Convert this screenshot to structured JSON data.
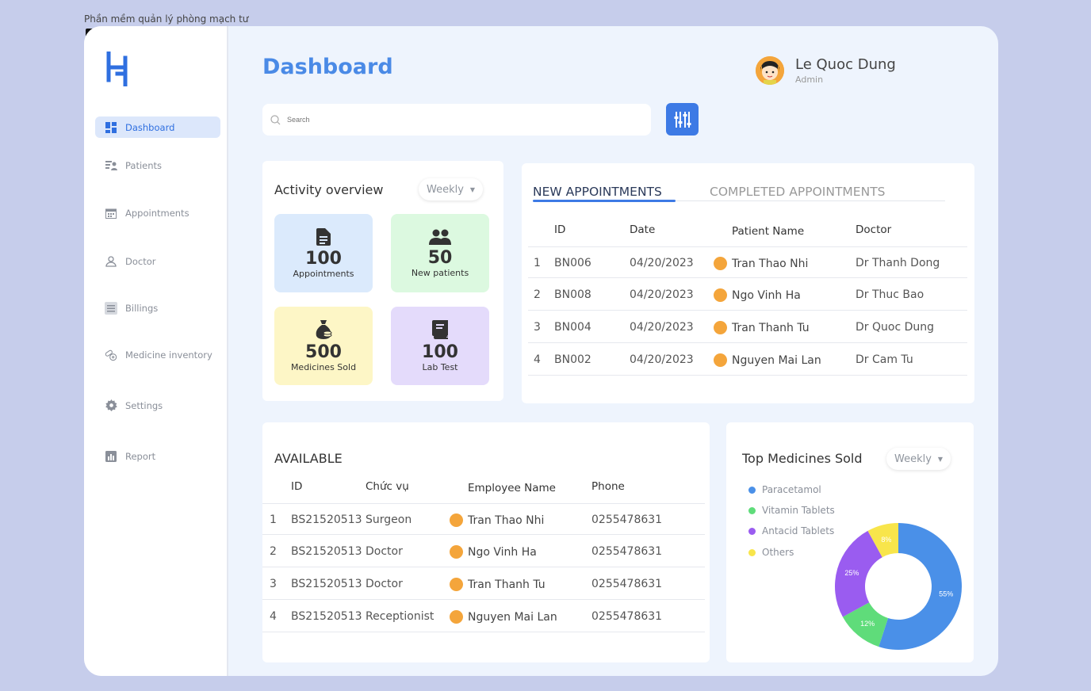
{
  "window_title": "Phần mềm quản lý phòng mạch tư",
  "sidebar": {
    "items": [
      {
        "label": "Dashboard",
        "icon": "dashboard-icon",
        "active": true
      },
      {
        "label": "Patients",
        "icon": "patients-icon"
      },
      {
        "label": "Appointments",
        "icon": "calendar-icon"
      },
      {
        "label": "Doctor",
        "icon": "doctor-icon"
      },
      {
        "label": "Billings",
        "icon": "billing-icon"
      },
      {
        "label": "Medicine inventory",
        "icon": "medicine-icon"
      },
      {
        "label": "Settings",
        "icon": "gear-icon"
      },
      {
        "label": "Report",
        "icon": "report-icon"
      }
    ]
  },
  "header": {
    "title": "Dashboard",
    "user_name": "Le Quoc Dung",
    "user_role": "Admin",
    "search_placeholder": "Search"
  },
  "activity": {
    "title": "Activity overview",
    "period": "Weekly",
    "stats": [
      {
        "value": "100",
        "label": "Appointments",
        "color": "#dbeafc",
        "icon": "document-icon"
      },
      {
        "value": "50",
        "label": "New patients",
        "color": "#dcf9e0",
        "icon": "users-icon"
      },
      {
        "value": "500",
        "label": "Medicines Sold",
        "color": "#fdf6c6",
        "icon": "money-bag-icon"
      },
      {
        "value": "100",
        "label": "Lab Test",
        "color": "#e4dbfb",
        "icon": "book-icon"
      }
    ]
  },
  "appointments": {
    "tab_new": "NEW APPOINTMENTS",
    "tab_completed": "COMPLETED APPOINTMENTS",
    "headers": [
      "ID",
      "Date",
      "Patient Name",
      "Doctor"
    ],
    "rows": [
      {
        "n": "1",
        "id": "BN006",
        "date": "04/20/2023",
        "patient": "Tran Thao Nhi",
        "doctor": "Dr Thanh Dong"
      },
      {
        "n": "2",
        "id": "BN008",
        "date": "04/20/2023",
        "patient": "Ngo Vinh Ha",
        "doctor": "Dr Thuc Bao"
      },
      {
        "n": "3",
        "id": "BN004",
        "date": "04/20/2023",
        "patient": "Tran Thanh Tu",
        "doctor": "Dr Quoc Dung"
      },
      {
        "n": "4",
        "id": "BN002",
        "date": "04/20/2023",
        "patient": "Nguyen Mai Lan",
        "doctor": "Dr Cam Tu"
      }
    ]
  },
  "available": {
    "title": "AVAILABLE",
    "headers": [
      "ID",
      "Chức vụ",
      "Employee Name",
      "Phone"
    ],
    "rows": [
      {
        "n": "1",
        "id": "BS21520513",
        "role": "Surgeon",
        "name": "Tran Thao Nhi",
        "phone": "0255478631"
      },
      {
        "n": "2",
        "id": "BS21520513",
        "role": "Doctor",
        "name": "Ngo Vinh Ha",
        "phone": "0255478631"
      },
      {
        "n": "3",
        "id": "BS21520513",
        "role": "Doctor",
        "name": "Tran Thanh Tu",
        "phone": "0255478631"
      },
      {
        "n": "4",
        "id": "BS21520513",
        "role": "Receptionist",
        "name": "Nguyen Mai Lan",
        "phone": "0255478631"
      }
    ]
  },
  "top_medicines": {
    "title": "Top Medicines Sold",
    "period": "Weekly",
    "legend": [
      {
        "label": "Paracetamol",
        "color": "#4a90e8"
      },
      {
        "label": "Vitamin Tablets",
        "color": "#5fdc7a"
      },
      {
        "label": "Antacid Tablets",
        "color": "#9a5cf0"
      },
      {
        "label": "Others",
        "color": "#f8e54b"
      }
    ]
  },
  "chart_data": {
    "type": "pie",
    "categories": [
      "Paracetamol",
      "Vitamin Tablets",
      "Antacid Tablets",
      "Others"
    ],
    "values": [
      55,
      12,
      25,
      8
    ],
    "labels": [
      "55%",
      "12%",
      "25%",
      "8%"
    ],
    "colors": [
      "#4a90e8",
      "#5fdc7a",
      "#9a5cf0",
      "#f8e54b"
    ]
  }
}
